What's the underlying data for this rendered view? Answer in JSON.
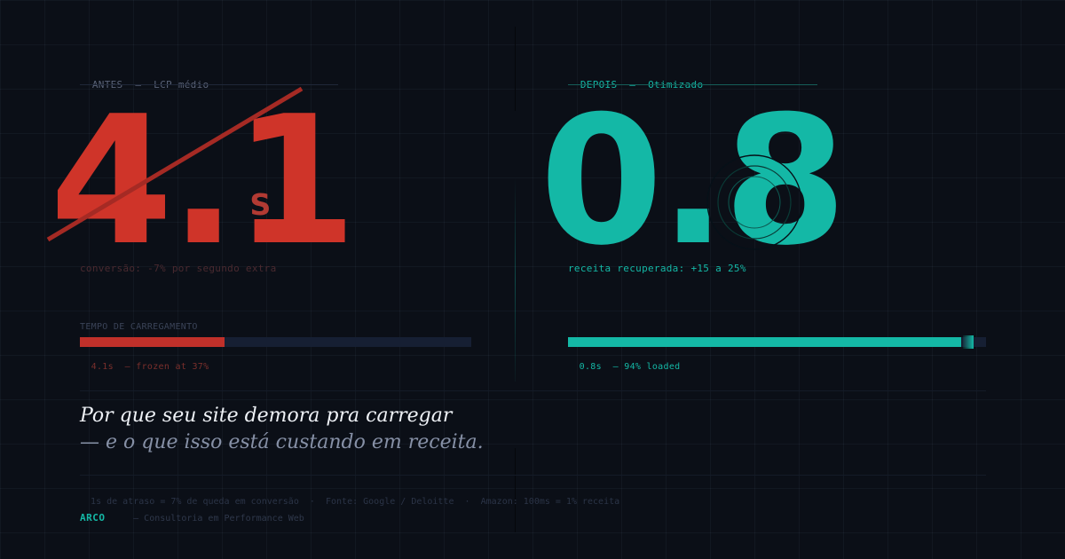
{
  "colors": {
    "background": "#0b0f17",
    "before_accent": "#cf3429",
    "after_accent": "#14b8a6",
    "muted": "#5b6479"
  },
  "before": {
    "label": "ANTES",
    "separator": "—",
    "title": "LCP médio",
    "value": "4.1",
    "unit": "s",
    "caption": "conversão: -7% por segundo extra"
  },
  "after": {
    "label": "DEPOIS",
    "separator": "—",
    "title": "Otimizado",
    "value": "0.8",
    "caption": "receita recuperada: +15 a 25%"
  },
  "load_section": {
    "title": "TEMPO DE CARREGAMENTO"
  },
  "before_bar": {
    "progress_percent": 37,
    "time": "4.1s",
    "note": "— frozen at 37%"
  },
  "after_bar": {
    "progress_percent": 94,
    "time": "0.8s",
    "note": "— 94% loaded"
  },
  "headline": {
    "line1": "Por que seu site demora pra carregar",
    "line2": "— e o que isso está custando em receita."
  },
  "footer": {
    "stat1": "1s de atraso = 7% de queda em conversão",
    "dot": "·",
    "stat2": "Fonte: Google / Deloitte",
    "stat3": "Amazon: 100ms = 1% receita",
    "brand": "ARCO",
    "tagline": "— Consultoria em Performance Web"
  }
}
